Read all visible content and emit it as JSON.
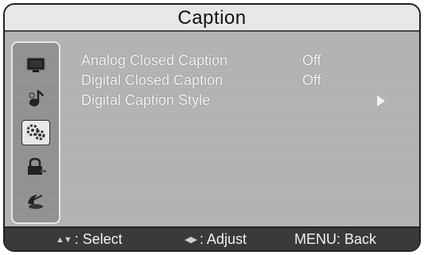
{
  "title": "Caption",
  "sidebar": {
    "items": [
      {
        "icon": "picture-icon"
      },
      {
        "icon": "sound-icon"
      },
      {
        "icon": "setup-icon"
      },
      {
        "icon": "lock-icon"
      },
      {
        "icon": "channel-icon"
      }
    ]
  },
  "menu": {
    "rows": [
      {
        "label": "Analog Closed Caption",
        "value": "Off"
      },
      {
        "label": "Digital Closed Caption",
        "value": "Off"
      },
      {
        "label": "Digital Caption Style",
        "value": ""
      }
    ]
  },
  "footer": {
    "select_glyph": "▲▼",
    "select_label": ": Select",
    "adjust_glyph": "◀▶",
    "adjust_label": ": Adjust",
    "back_label": "MENU: Back"
  }
}
